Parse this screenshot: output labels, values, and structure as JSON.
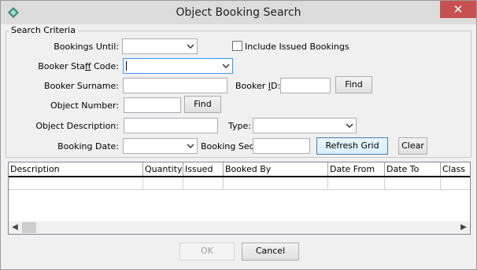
{
  "window": {
    "title": "Object Booking Search",
    "close_glyph": "✕"
  },
  "criteria": {
    "legend": "Search Criteria",
    "bookings_until_label": "Bookings Until:",
    "include_issued_label": "Include Issued Bookings",
    "staff_code_pre": "Booker Sta",
    "staff_code_u": "f",
    "staff_code_post": "f Code:",
    "surname_label": "Booker Surname:",
    "booker_id_pre": "Booker ",
    "booker_id_u": "I",
    "booker_id_post": "D:",
    "object_number_label": "Object Number:",
    "object_description_label": "Object Description:",
    "type_label": "Type:",
    "booking_date_label": "Booking Date:",
    "booking_seq_label": "Booking Seq:",
    "find_label": "Find",
    "find2_label": "Find",
    "refresh_label": "Refresh Grid",
    "clear_label": "Clear"
  },
  "grid": {
    "columns": [
      "Description",
      "Quantity",
      "Issued",
      "Booked By",
      "Date From",
      "Date To",
      "Class"
    ]
  },
  "footer": {
    "ok_label": "OK",
    "cancel_label": "Cancel"
  }
}
